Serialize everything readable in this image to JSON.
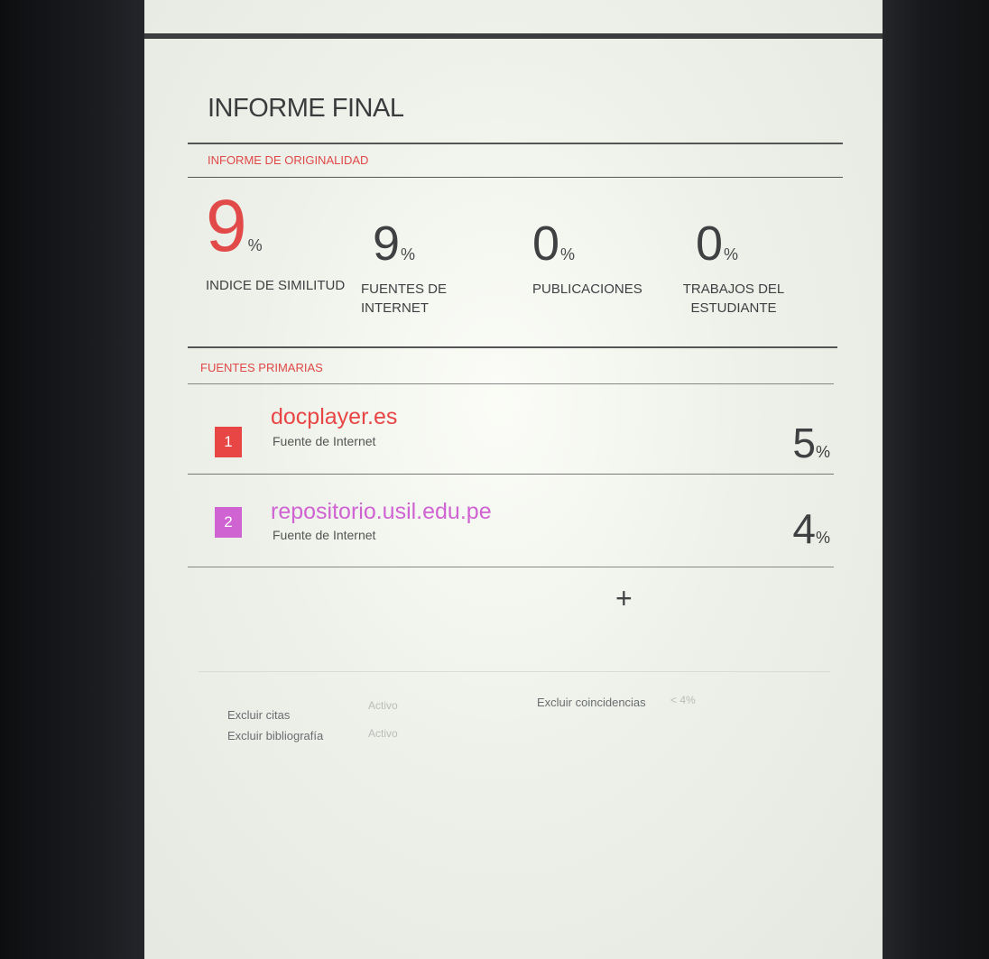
{
  "report": {
    "title": "INFORME FINAL",
    "originality_label": "INFORME DE ORIGINALIDAD",
    "metrics": [
      {
        "value": "9",
        "unit": "%",
        "label": "INDICE DE SIMILITUD"
      },
      {
        "value": "9",
        "unit": "%",
        "label": "FUENTES DE INTERNET"
      },
      {
        "value": "0",
        "unit": "%",
        "label": "PUBLICACIONES"
      },
      {
        "value": "0",
        "unit": "%",
        "label": "TRABAJOS DEL ESTUDIANTE"
      }
    ],
    "primary_label": "FUENTES PRIMARIAS",
    "sources": [
      {
        "rank": "1",
        "name": "docplayer.es",
        "type": "Fuente de Internet",
        "value": "5",
        "unit": "%",
        "color": "#e84545"
      },
      {
        "rank": "2",
        "name": "repositorio.usil.edu.pe",
        "type": "Fuente de Internet",
        "value": "4",
        "unit": "%",
        "color": "#cf63d2"
      }
    ],
    "expand_symbol": "+",
    "filters": {
      "exclude_citations_label": "Excluir citas",
      "exclude_citations_value": "Activo",
      "exclude_bibliography_label": "Excluir bibliografía",
      "exclude_bibliography_value": "Activo",
      "exclude_matches_label": "Excluir coincidencias",
      "exclude_matches_value": "< 4%"
    }
  }
}
